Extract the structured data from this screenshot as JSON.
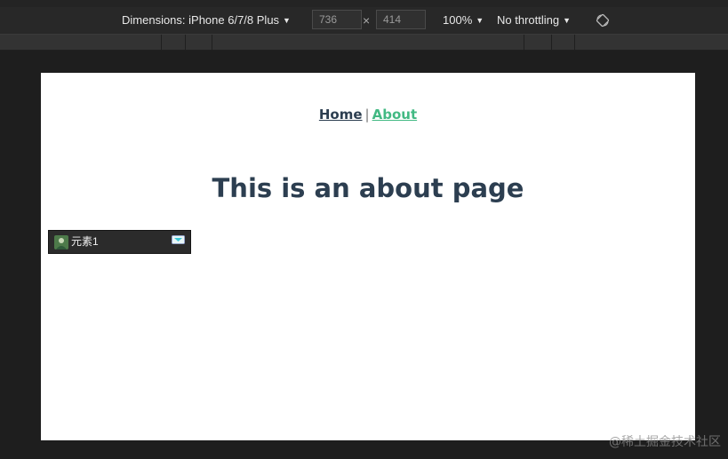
{
  "devtools": {
    "dimensions_label": "Dimensions: iPhone 6/7/8 Plus",
    "width_value": "736",
    "times": "×",
    "height_value": "414",
    "zoom": "100%",
    "throttling": "No throttling",
    "caret": "▼"
  },
  "page": {
    "nav": {
      "home": "Home",
      "separator": "|",
      "about": "About"
    },
    "heading": "This is an about page"
  },
  "chip": {
    "label": "元素1"
  },
  "watermark": "@稀土掘金技术社区",
  "colors": {
    "text": "#2c3e50",
    "link_active": "#42b983",
    "toolbar_bg": "#282828",
    "page_bg": "#1e1e1e"
  }
}
